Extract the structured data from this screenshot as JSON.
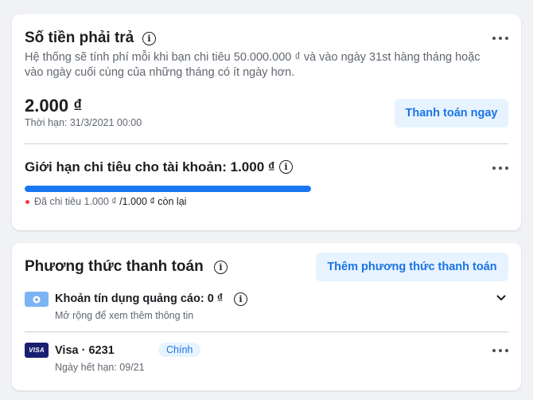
{
  "amount_due": {
    "title": "Số tiền phải trả",
    "description": "Hệ thống sẽ tính phí mỗi khi bạn chi tiêu 50.000.000 ₫ và vào ngày 31st hàng tháng hoặc vào ngày cuối cùng của những tháng có ít ngày hơn.",
    "amount": "2.000 ₫",
    "due_date": "Thời hạn: 31/3/2021 00:00",
    "pay_button": "Thanh toán ngay"
  },
  "spending_limit": {
    "title": "Giới hạn chi tiêu cho tài khoản: 1.000 ₫",
    "spent_text": "Đã chi tiêu 1.000 ₫",
    "limit_text": "/1.000 ₫ còn lại",
    "progress_fraction": 1.0,
    "progress_color": "#1877f2"
  },
  "payment_methods": {
    "title": "Phương thức thanh toán",
    "add_button": "Thêm phương thức thanh toán",
    "ad_credit": {
      "label": "Khoản tín dụng quảng cáo: 0 ₫",
      "hint": "Mở rộng để xem thêm thông tin",
      "icon": "ad-credit-icon"
    },
    "card": {
      "brand_text": "VISA",
      "label": "Visa · 6231",
      "badge": "Chính",
      "expiry": "Ngày hết hạn: 09/21"
    }
  },
  "colors": {
    "accent": "#1b74e4",
    "button_bg": "#e7f3ff",
    "background": "#f0f2f5"
  }
}
